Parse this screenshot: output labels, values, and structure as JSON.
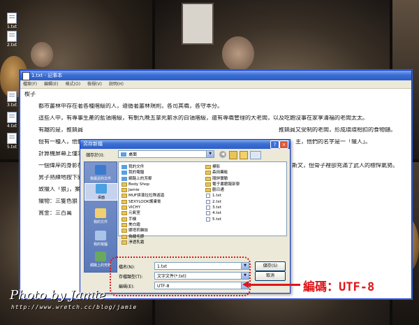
{
  "desktop": {
    "icons": [
      {
        "label": "1.txt"
      },
      {
        "label": "2.txt"
      },
      {
        "label": "3.txt"
      },
      {
        "label": "4.txt"
      },
      {
        "label": "5.txt"
      }
    ],
    "watermark_title": "Photo by Jamie",
    "watermark_url": "http://www.wretch.cc/blog/jamie",
    "signature": "Jamie"
  },
  "notepad": {
    "title": "1.txt - 記事本",
    "menu": [
      "檔案(F)",
      "編輯(E)",
      "格式(O)",
      "檢視(V)",
      "說明(H)"
    ],
    "lines": [
      {
        "text": "楔子",
        "indent": false
      },
      {
        "text": "都市叢林中存在著各種階級的人，遵循著叢林規則，各司其職，各守本分。",
        "indent": true
      },
      {
        "text": "這些人中，有專事生產的藍領階級，有朝九晚五拿死薪水的白領階級，還有專職管理的大老闆，以及吃飽沒事在家享清福的老闆太太。",
        "indent": true
      },
      {
        "text": "有趣的是，推銷員",
        "indent": true,
        "tail": "推銷員又受制的老闆，形成環環相扣的食物鏈。"
      },
      {
        "text": "但有一種人，他們",
        "indent": true,
        "tail": "主，他們的名字是一「獵人」。"
      },
      {
        "text": "計算機屏幕上僅求",
        "indent": true
      },
      {
        "text": "一個偉岸的身影在",
        "indent": true,
        "tail": "斯文，但骨子裡卻充滿了武人的標悍氣勢。"
      },
      {
        "text": "男子熟練地按下開",
        "indent": true
      },
      {
        "text": "致獵人「狼」，案",
        "indent": true
      },
      {
        "text": "獵物：三隻色狼",
        "indent": true
      },
      {
        "text": "賞金：三百萬",
        "indent": true
      }
    ]
  },
  "save_dialog": {
    "title": "另存新檔",
    "save_in_label": "儲存於(I):",
    "save_in_value": "桌面",
    "places": [
      {
        "label": "我最近的文件",
        "selected": false
      },
      {
        "label": "桌面",
        "selected": true
      },
      {
        "label": "我的文件",
        "selected": false
      },
      {
        "label": "我的電腦",
        "selected": false
      },
      {
        "label": "網路上的芳鄰",
        "selected": false
      }
    ],
    "files_col1": [
      {
        "name": "我的文件",
        "kind": "sys"
      },
      {
        "name": "我的電腦",
        "kind": "sys"
      },
      {
        "name": "網路上的芳鄰",
        "kind": "sys"
      },
      {
        "name": "Body Shop",
        "kind": "folder"
      },
      {
        "name": "Jamie",
        "kind": "folder"
      },
      {
        "name": "MUF拼湊拉拉隊遊迦",
        "kind": "folder"
      },
      {
        "name": "SEXYLOOK護膚膏",
        "kind": "folder"
      },
      {
        "name": "VICHY",
        "kind": "folder"
      },
      {
        "name": "元氣室",
        "kind": "folder"
      },
      {
        "name": "手機",
        "kind": "folder"
      },
      {
        "name": "美白霜",
        "kind": "folder"
      },
      {
        "name": "娜塔莉雜誌",
        "kind": "folder"
      },
      {
        "name": "偽睫毛膠",
        "kind": "folder"
      },
      {
        "name": "淨透乳霜",
        "kind": "folder"
      }
    ],
    "files_col2": [
      {
        "name": "標影",
        "kind": "folder"
      },
      {
        "name": "森田藥粧",
        "kind": "folder"
      },
      {
        "name": "隨詳實驗",
        "kind": "folder"
      },
      {
        "name": "電子書籍報部學",
        "kind": "folder"
      },
      {
        "name": "觀日通",
        "kind": "folder"
      },
      {
        "name": "1.txt",
        "kind": "doc"
      },
      {
        "name": "2.txt",
        "kind": "doc"
      },
      {
        "name": "3.txt",
        "kind": "doc"
      },
      {
        "name": "4.txt",
        "kind": "doc"
      },
      {
        "name": "5.txt",
        "kind": "doc"
      }
    ],
    "filename_label": "檔名(N):",
    "filename_value": "1.txt",
    "savetype_label": "存檔類型(T):",
    "savetype_value": "文字文件(*.txt)",
    "encoding_label": "編碼(E):",
    "encoding_value": "UTF-8",
    "save_button": "儲存(S)",
    "cancel_button": "取消"
  },
  "annotation": {
    "callout": "編碼：UTF-8"
  }
}
